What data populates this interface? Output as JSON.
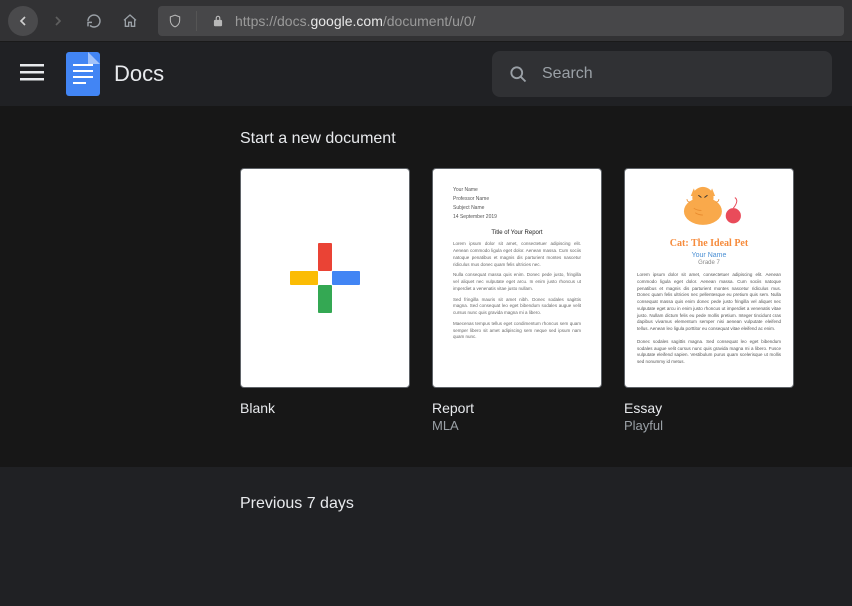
{
  "browser": {
    "url_prefix": "https://docs.",
    "url_host": "google.com",
    "url_path": "/document/u/0/"
  },
  "header": {
    "app_name": "Docs",
    "search_placeholder": "Search"
  },
  "gallery": {
    "title": "Start a new document",
    "templates": [
      {
        "name": "Blank",
        "subtitle": ""
      },
      {
        "name": "Report",
        "subtitle": "MLA"
      },
      {
        "name": "Essay",
        "subtitle": "Playful"
      }
    ]
  },
  "essay_preview": {
    "title": "Cat: The Ideal Pet",
    "name_line": "Your Name",
    "grade_line": "Grade 7"
  },
  "recent": {
    "title": "Previous 7 days"
  }
}
